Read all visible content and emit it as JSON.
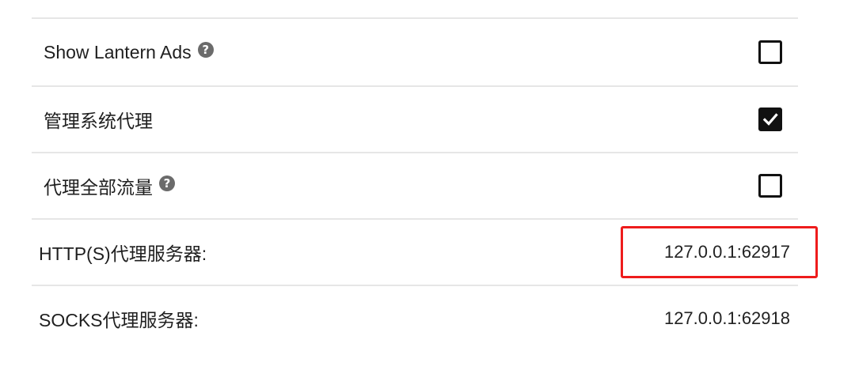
{
  "settings": {
    "show_lantern_ads": {
      "label": "Show Lantern Ads",
      "checked": false
    },
    "manage_system_proxy": {
      "label": "管理系统代理",
      "checked": true
    },
    "proxy_all_traffic": {
      "label": "代理全部流量",
      "checked": false
    },
    "http_proxy": {
      "label": "HTTP(S)代理服务器:",
      "value": "127.0.0.1:62917"
    },
    "socks_proxy": {
      "label": "SOCKS代理服务器:",
      "value": "127.0.0.1:62918"
    }
  },
  "icons": {
    "help": "question-circle-icon",
    "check": "checkmark-icon"
  },
  "colors": {
    "highlight_border": "#ee1c1c",
    "divider": "#e6e6e6",
    "checkbox": "#111111"
  }
}
